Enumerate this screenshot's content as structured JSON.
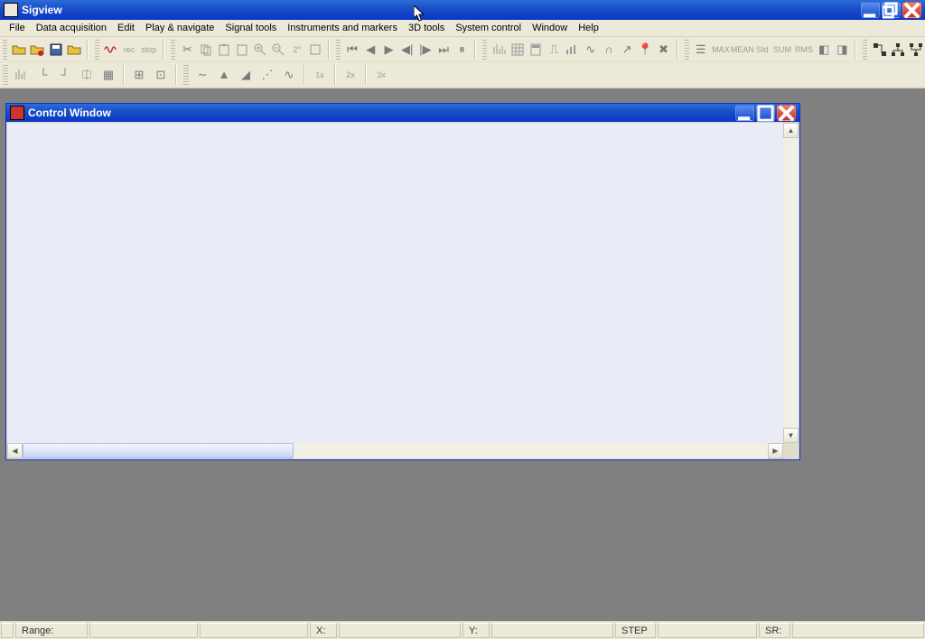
{
  "app": {
    "title": "Sigview"
  },
  "menus": [
    "File",
    "Data acquisition",
    "Edit",
    "Play & navigate",
    "Signal tools",
    "Instruments and markers",
    "3D tools",
    "System control",
    "Window",
    "Help"
  ],
  "childwin": {
    "title": "Control Window"
  },
  "toolbar_row1": {
    "g1": [
      "open",
      "open-red",
      "save",
      "open-alt"
    ],
    "g2": [
      "wave",
      "rec",
      "stop"
    ],
    "g3": [
      "cut",
      "copy",
      "paste",
      "paste-special",
      "zoom-in",
      "zoom-out",
      "zoom-2",
      "info"
    ],
    "g4": [
      "first",
      "prev",
      "play",
      "rev-step",
      "step",
      "last",
      "pause"
    ],
    "g5": [
      "spectrum",
      "grid",
      "calc",
      "fun-1",
      "bars",
      "pulse",
      "filter",
      "trend",
      "pin",
      "tools"
    ],
    "g6": [
      "stat-1",
      "max",
      "mean",
      "std",
      "sum",
      "rms",
      "stat-7",
      "stat-8"
    ],
    "g7": [
      "net-1",
      "net-2",
      "net-3"
    ]
  },
  "toolbar_row2": {
    "g1": [
      "chart-1",
      "chart-2",
      "chart-3",
      "chart-4",
      "chart-5"
    ],
    "g2": [
      "grid-a",
      "grid-b"
    ],
    "g3": [
      "wave-a",
      "wave-b",
      "wave-c",
      "wave-d",
      "wave-e"
    ],
    "rates": [
      "1x",
      "2x",
      "3x"
    ]
  },
  "status": {
    "range_label": "Range:",
    "x_label": "X:",
    "y_label": "Y:",
    "step_label": "STEP",
    "sr_label": "SR:"
  }
}
